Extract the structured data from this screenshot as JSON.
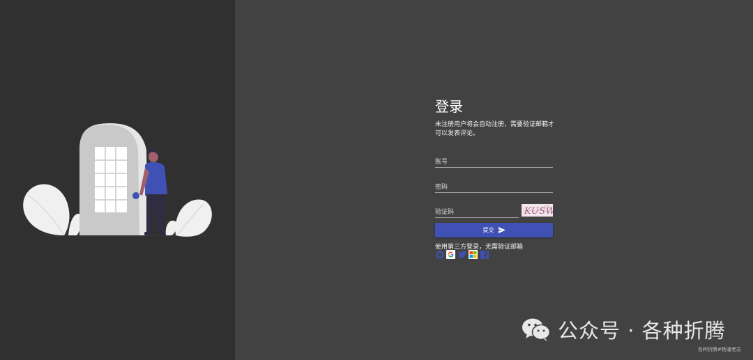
{
  "login": {
    "title": "登录",
    "subtitle": "未注册用户将会自动注册，需要验证邮箱才可以发表评论。",
    "account_placeholder": "账号",
    "password_placeholder": "密码",
    "captcha_placeholder": "验证码",
    "captcha_text": "KUSW",
    "submit_label": "提交",
    "third_party_text": "使用第三方登录，无需验证邮箱",
    "social": [
      "github-icon",
      "google-icon",
      "twitter-icon",
      "microsoft-icon",
      "facebook-icon"
    ]
  },
  "watermark": {
    "main": "公众号 · 各种折腾",
    "sub": "各种折腾#杨浦老苏"
  },
  "colors": {
    "left_bg": "#303030",
    "right_bg": "#424242",
    "accent": "#3f51b5"
  }
}
